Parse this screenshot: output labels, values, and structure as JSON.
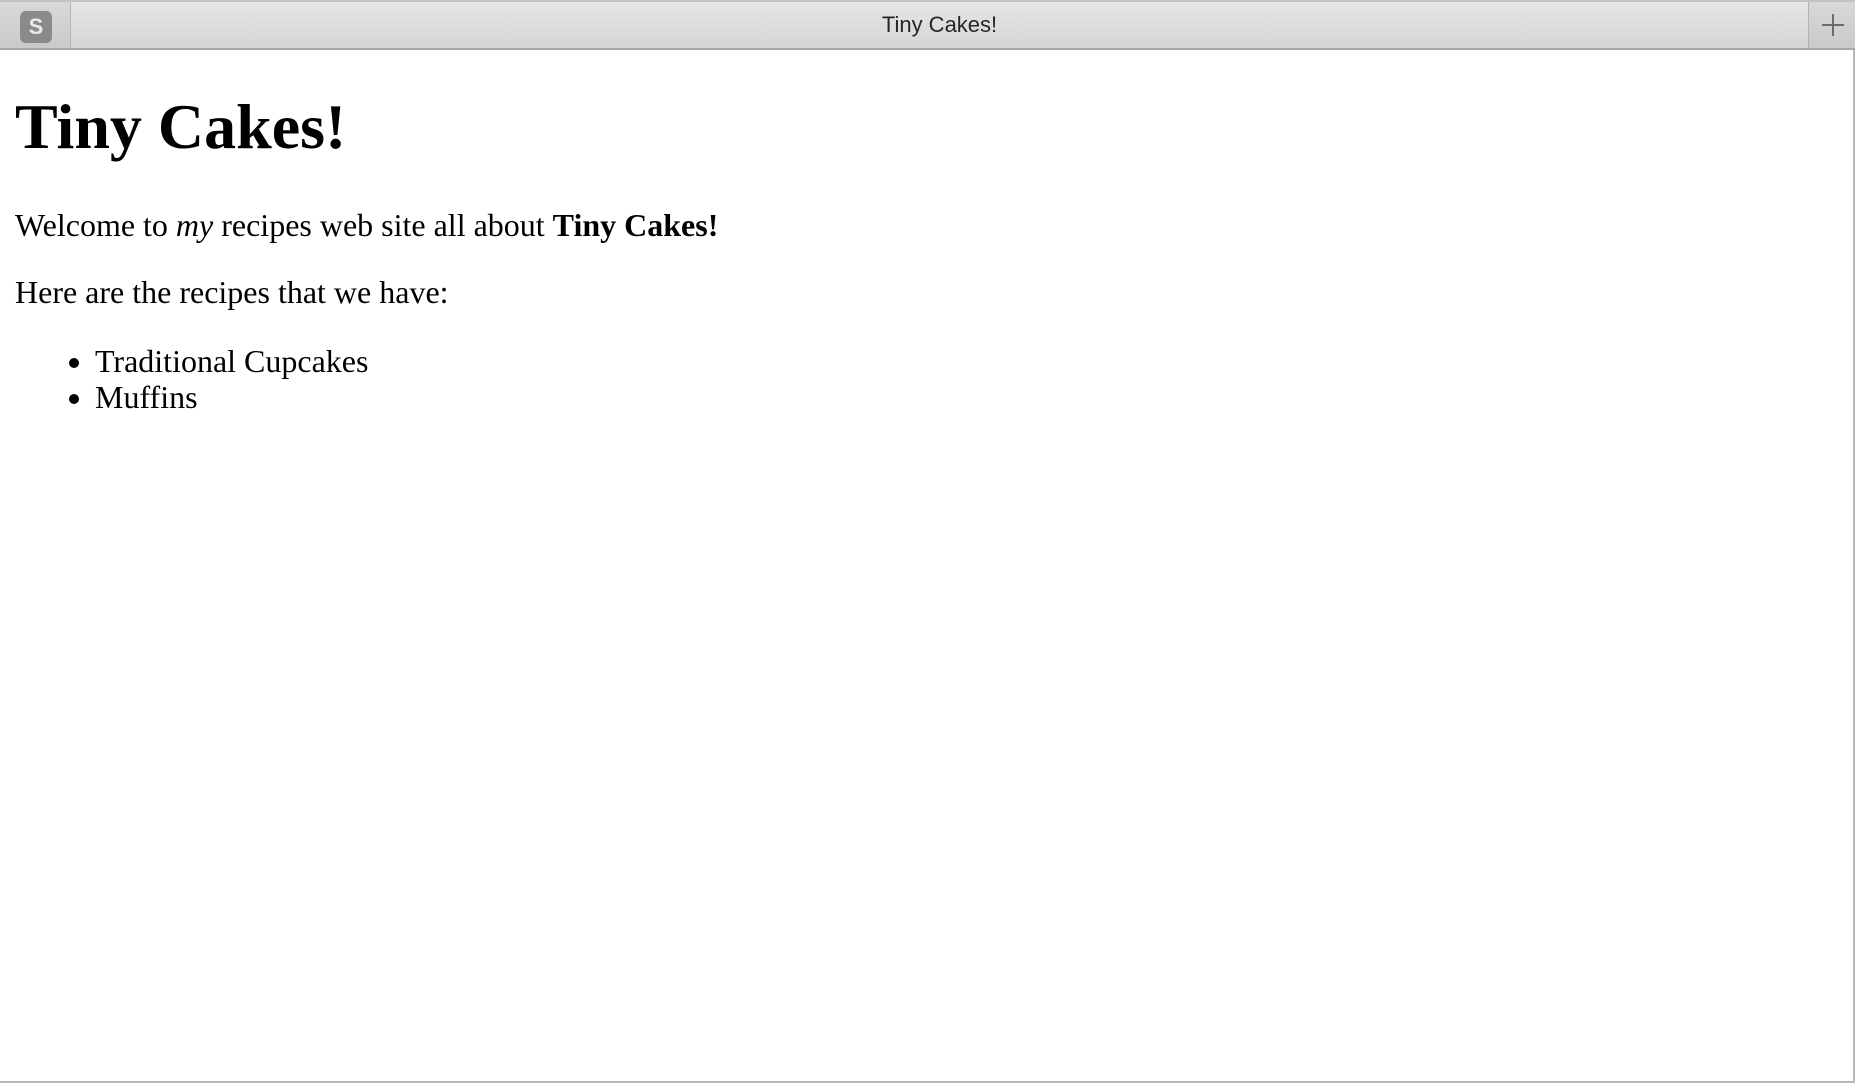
{
  "browser": {
    "site_icon_letter": "S",
    "tab_title": "Tiny Cakes!",
    "new_tab_icon": "plus-icon"
  },
  "page": {
    "heading": "Tiny Cakes!",
    "welcome": {
      "before_emphasis": "Welcome to ",
      "emphasis": "my",
      "middle": " recipes web site all about ",
      "strong": "Tiny Cakes!"
    },
    "intro": "Here are the recipes that we have:",
    "recipes": [
      "Traditional Cupcakes",
      "Muffins"
    ]
  }
}
